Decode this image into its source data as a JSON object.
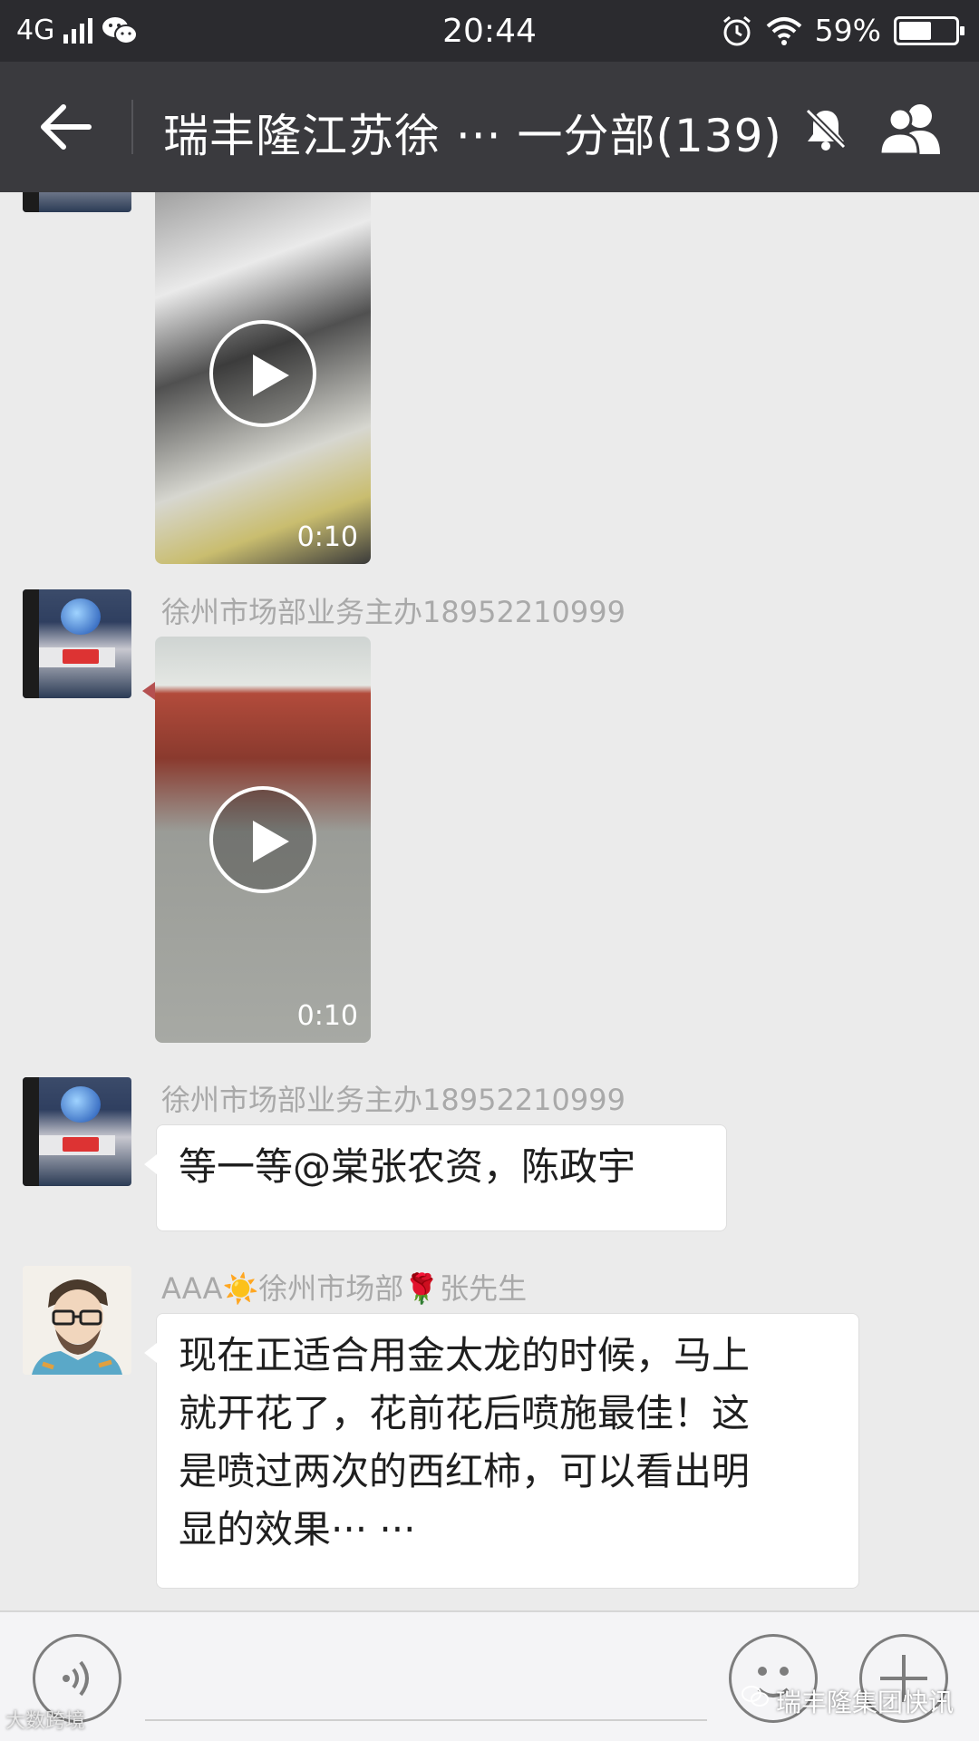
{
  "status_bar": {
    "network": "4G",
    "time": "20:44",
    "battery_percent": "59%",
    "battery_level": 0.59
  },
  "header": {
    "title": "瑞丰隆江苏徐 ··· 一分部(139)"
  },
  "messages": [
    {
      "type": "video",
      "duration": "0:10"
    },
    {
      "type": "video",
      "sender": "徐州市场部业务主办18952210999",
      "duration": "0:10"
    },
    {
      "type": "text",
      "sender": "徐州市场部业务主办18952210999",
      "text": "等一等@棠张农资，陈政宇"
    },
    {
      "type": "text",
      "sender": "AAA☀️徐州市场部🌹张先生",
      "lines": [
        "现在正适合用金太龙的时候，马上",
        "就开花了，花前花后喷施最佳！这",
        "是喷过两次的西红柿，可以看出明",
        "显的效果··· ···"
      ]
    }
  ],
  "watermarks": {
    "left": "大数跨境",
    "right": "瑞丰隆集团快讯"
  },
  "icons": {
    "back": "arrow-left-icon",
    "mute": "bell-off-icon",
    "group": "group-members-icon",
    "voice": "voice-icon",
    "emoji": "emoji-icon",
    "plus": "plus-icon"
  }
}
